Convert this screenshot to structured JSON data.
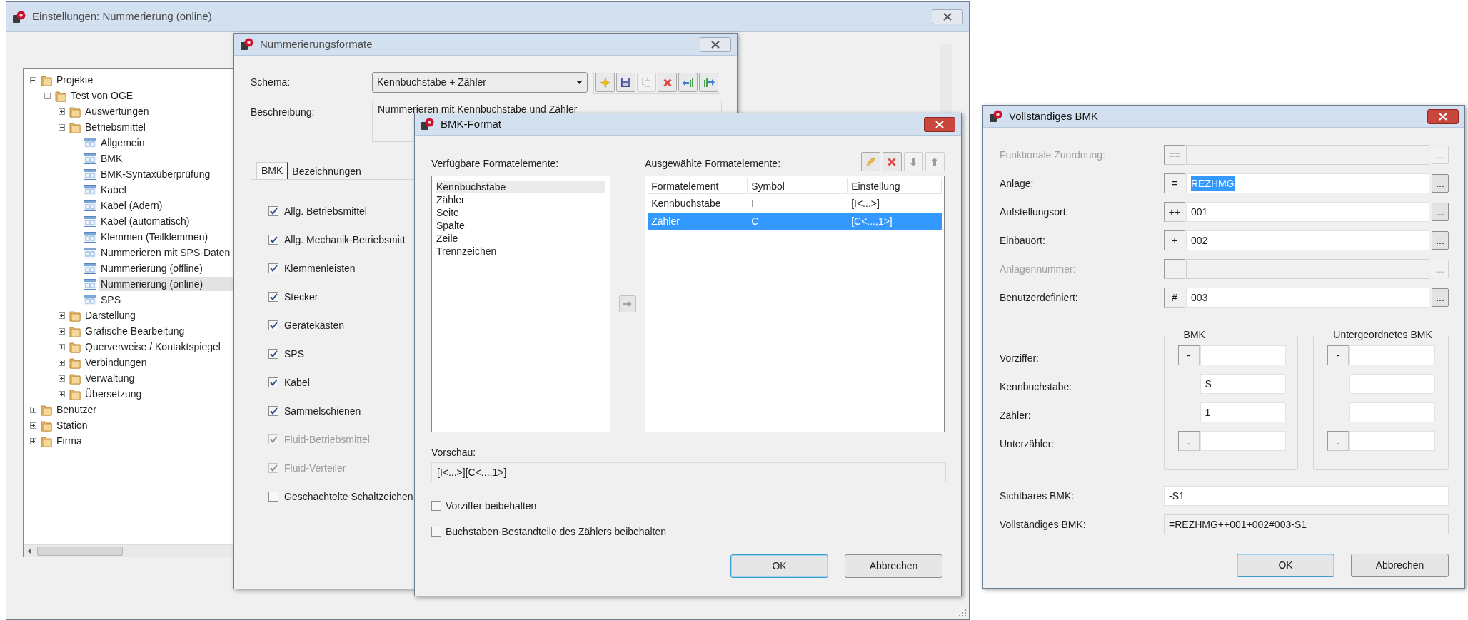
{
  "main_window": {
    "title": "Einstellungen: Nummerierung (online)",
    "active": false,
    "tree": [
      {
        "label": "Projekte",
        "kind": "folder",
        "expanded": true,
        "selected": false,
        "children": [
          {
            "label": "Test von OGE",
            "kind": "folder",
            "expanded": true,
            "selected": false,
            "children": [
              {
                "label": "Auswertungen",
                "kind": "folder",
                "expanded": false,
                "selected": false
              },
              {
                "label": "Betriebsmittel",
                "kind": "folder",
                "expanded": true,
                "selected": false,
                "children": [
                  {
                    "label": "Allgemein",
                    "kind": "page",
                    "selected": false
                  },
                  {
                    "label": "BMK",
                    "kind": "page",
                    "selected": false
                  },
                  {
                    "label": "BMK-Syntaxüberprüfung",
                    "kind": "page",
                    "selected": false
                  },
                  {
                    "label": "Kabel",
                    "kind": "page",
                    "selected": false
                  },
                  {
                    "label": "Kabel (Adern)",
                    "kind": "page",
                    "selected": false
                  },
                  {
                    "label": "Kabel (automatisch)",
                    "kind": "page",
                    "selected": false
                  },
                  {
                    "label": "Klemmen (Teilklemmen)",
                    "kind": "page",
                    "selected": false
                  },
                  {
                    "label": "Nummerieren mit SPS-Daten",
                    "kind": "page",
                    "selected": false
                  },
                  {
                    "label": "Nummerierung (offline)",
                    "kind": "page",
                    "selected": false
                  },
                  {
                    "label": "Nummerierung (online)",
                    "kind": "page",
                    "selected": true
                  },
                  {
                    "label": "SPS",
                    "kind": "page",
                    "selected": false
                  }
                ]
              },
              {
                "label": "Darstellung",
                "kind": "folder",
                "expanded": false,
                "selected": false
              },
              {
                "label": "Grafische Bearbeitung",
                "kind": "folder",
                "expanded": false,
                "selected": false
              },
              {
                "label": "Querverweise / Kontaktspiegel",
                "kind": "folder",
                "expanded": false,
                "selected": false
              },
              {
                "label": "Verbindungen",
                "kind": "folder",
                "expanded": false,
                "selected": false
              },
              {
                "label": "Verwaltung",
                "kind": "folder",
                "expanded": false,
                "selected": false
              },
              {
                "label": "Übersetzung",
                "kind": "folder",
                "expanded": false,
                "selected": false
              }
            ]
          }
        ]
      },
      {
        "label": "Benutzer",
        "kind": "folder",
        "expanded": false,
        "selected": false
      },
      {
        "label": "Station",
        "kind": "folder",
        "expanded": false,
        "selected": false
      },
      {
        "label": "Firma",
        "kind": "folder",
        "expanded": false,
        "selected": false
      }
    ]
  },
  "numbering_dialog": {
    "title": "Nummerierungsformate",
    "active": false,
    "schema_label": "Schema:",
    "schema_value": "Kennbuchstabe + Zähler",
    "toolbar": [
      {
        "kind": "new",
        "disabled": false
      },
      {
        "kind": "save",
        "disabled": false
      },
      {
        "kind": "copy",
        "disabled": true
      },
      {
        "kind": "delete",
        "disabled": false
      },
      {
        "kind": "import",
        "disabled": false
      },
      {
        "kind": "export",
        "disabled": false
      }
    ],
    "description_label": "Beschreibung:",
    "description": "Nummerieren mit Kennbuchstabe und Zähler",
    "tabs": [
      {
        "label": "BMK",
        "selected": true
      },
      {
        "label": "Bezeichnungen",
        "selected": false
      }
    ],
    "options": [
      {
        "label": "Allg. Betriebsmittel",
        "checked": true,
        "disabled": false
      },
      {
        "label": "Allg. Mechanik-Betriebsmitt",
        "checked": true,
        "disabled": false
      },
      {
        "label": "Klemmenleisten",
        "checked": true,
        "disabled": false
      },
      {
        "label": "Stecker",
        "checked": true,
        "disabled": false
      },
      {
        "label": "Gerätekästen",
        "checked": true,
        "disabled": false
      },
      {
        "label": "SPS",
        "checked": true,
        "disabled": false
      },
      {
        "label": "Kabel",
        "checked": true,
        "disabled": false
      },
      {
        "label": "Sammelschienen",
        "checked": true,
        "disabled": false
      },
      {
        "label": "Fluid-Betriebsmittel",
        "checked": true,
        "disabled": true
      },
      {
        "label": "Fluid-Verteiler",
        "checked": true,
        "disabled": true
      },
      {
        "label": "Geschachtelte Schaltzeichen",
        "checked": false,
        "disabled": false
      }
    ]
  },
  "bmk_format_dialog": {
    "title": "BMK-Format",
    "active": true,
    "available_label": "Verfügbare Formatelemente:",
    "available": [
      {
        "label": "Kennbuchstabe",
        "selected": true
      },
      {
        "label": "Zähler",
        "selected": false
      },
      {
        "label": "Seite",
        "selected": false
      },
      {
        "label": "Spalte",
        "selected": false
      },
      {
        "label": "Zeile",
        "selected": false
      },
      {
        "label": "Trennzeichen",
        "selected": false
      }
    ],
    "add_button": {
      "disabled": true
    },
    "selected_label": "Ausgewählte Formatelemente:",
    "toolbar": [
      {
        "kind": "edit",
        "disabled": false
      },
      {
        "kind": "delete",
        "disabled": false
      },
      {
        "kind": "down",
        "disabled": true
      },
      {
        "kind": "up",
        "disabled": true
      }
    ],
    "columns": [
      "Formatelement",
      "Symbol",
      "Einstellung"
    ],
    "rows": [
      {
        "cells": [
          "Kennbuchstabe",
          "I",
          "[I<...>]"
        ],
        "selected": false
      },
      {
        "cells": [
          "Zähler",
          "C",
          "[C<...,1>]"
        ],
        "selected": true
      }
    ],
    "preview_label": "Vorschau:",
    "preview": "[I<...>][C<...,1>]",
    "options": [
      {
        "label": "Vorziffer beibehalten",
        "checked": false
      },
      {
        "label": "Buchstaben-Bestandteile des Zählers beibehalten",
        "checked": false
      }
    ],
    "buttons": [
      {
        "label": "OK",
        "default": true
      },
      {
        "label": "Abbrechen",
        "default": false
      }
    ]
  },
  "full_bmk_dialog": {
    "title": "Vollständiges BMK",
    "active": true,
    "rows": [
      {
        "label": "Funktionale Zuordnung:",
        "prefix": "==",
        "disabled": true,
        "button": "..."
      },
      {
        "label": "Anlage:",
        "prefix": "=",
        "value": "REZHMG",
        "value_selected": true,
        "disabled": false,
        "button": "..."
      },
      {
        "label": "Aufstellungsort:",
        "prefix": "++",
        "value": "001",
        "value_selected": false,
        "disabled": false,
        "button": "..."
      },
      {
        "label": "Einbauort:",
        "prefix": "+",
        "value": "002",
        "value_selected": false,
        "disabled": false,
        "button": "..."
      },
      {
        "label": "Anlagennummer:",
        "disabled": true,
        "button": "..."
      },
      {
        "label": "Benutzerdefiniert:",
        "prefix": "#",
        "value": "003",
        "value_selected": false,
        "disabled": false,
        "button": "..."
      }
    ],
    "part_labels": [
      "Vorziffer:",
      "Kennbuchstabe:",
      "Zähler:",
      "Unterzähler:"
    ],
    "groups": [
      {
        "title": "BMK",
        "fields": [
          {
            "kind": "prefixed",
            "prefix": "-"
          },
          {
            "kind": "plain",
            "value": "S"
          },
          {
            "kind": "plain",
            "value": "1"
          },
          {
            "kind": "prefixed",
            "prefix": "."
          }
        ]
      },
      {
        "title": "Untergeordnetes BMK",
        "fields": [
          {
            "kind": "prefixed",
            "prefix": "-"
          },
          {
            "kind": "plain"
          },
          {
            "kind": "plain"
          },
          {
            "kind": "prefixed",
            "prefix": "."
          }
        ]
      }
    ],
    "visible_label": "Sichtbares BMK:",
    "visible_value": "-S1",
    "full_label": "Vollständiges BMK:",
    "full_value": "=REZHMG++001+002#003-S1",
    "buttons": [
      {
        "label": "OK",
        "default": true
      },
      {
        "label": "Abbrechen",
        "default": false
      }
    ]
  }
}
